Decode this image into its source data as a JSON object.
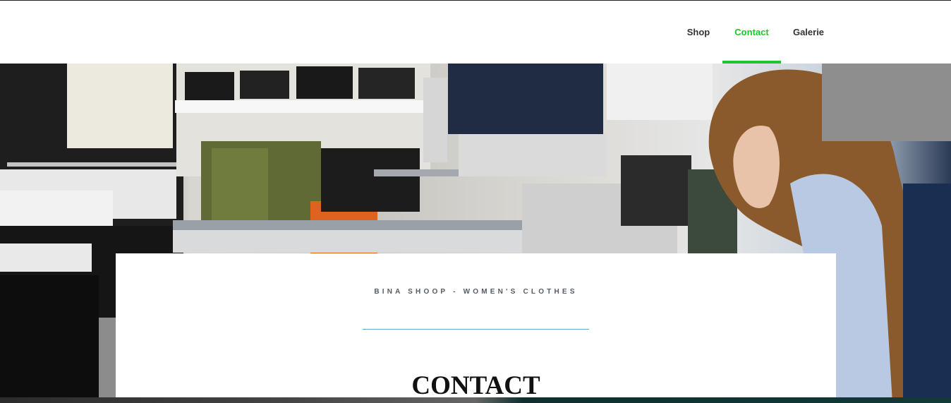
{
  "nav": {
    "items": [
      {
        "label": "Shop",
        "active": false
      },
      {
        "label": "Contact",
        "active": true
      },
      {
        "label": "Galerie",
        "active": false
      }
    ]
  },
  "hero": {
    "image": "clothing-store-photo"
  },
  "card": {
    "subtitle": "BINA SHOOP - WOMEN'S CLOTHES",
    "title": "CONTACT"
  },
  "colors": {
    "accent": "#1fc52f",
    "divider": "#6aa6c7",
    "text_dark": "#111111",
    "nav_text": "#333333"
  }
}
